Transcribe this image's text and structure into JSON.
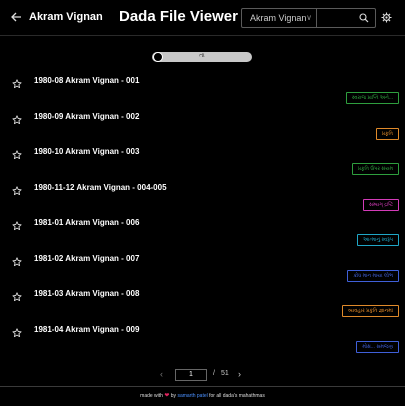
{
  "header": {
    "back_icon": "arrow-left-icon",
    "title": "Akram Vignan",
    "app_title": "Dada File Viewer",
    "select_value": "Akram Vignan",
    "search_placeholder": "",
    "search_icon": "search-icon",
    "settings_icon": "gear-icon"
  },
  "toggle": {
    "label": "તા",
    "state": "off"
  },
  "list": {
    "items": [
      {
        "title": "1980-08 Akram Vignan - 001",
        "tag": "સ્વરાજ પ્રાપ્તિ અને...",
        "tag_color": "#2e9e3e"
      },
      {
        "title": "1980-09 Akram Vignan - 002",
        "tag": "પ્રકૃતિ",
        "tag_color": "#e08a2a"
      },
      {
        "title": "1980-10 Akram Vignan - 003",
        "tag": "પ્રકૃતિ ઉપર સંયમ",
        "tag_color": "#2e9e3e"
      },
      {
        "title": "1980-11-12 Akram Vignan - 004-005",
        "tag": "સમ્યગ્ દ્રષ્ટિ",
        "tag_color": "#d33bb8"
      },
      {
        "title": "1981-01 Akram Vignan - 006",
        "tag": "આત્માનું સ્વરૂપ",
        "tag_color": "#1fa7c7"
      },
      {
        "title": "1981-02 Akram Vignan - 007",
        "tag": "ક્રોધ માન માયા લોભ",
        "tag_color": "#3f5fd8"
      },
      {
        "title": "1981-03 Akram Vignan - 008",
        "tag": "વ્યવહાર પ્રકૃતિ જ્ઞાનમાં",
        "tag_color": "#e08a2a"
      },
      {
        "title": "1981-04 Akram Vignan - 009",
        "tag": "મોક્ષ... સમજણ",
        "tag_color": "#3f5fd8"
      }
    ]
  },
  "pagination": {
    "prev_icon": "chevron-left-icon",
    "current_page": "1",
    "separator": "/",
    "total_pages": "51",
    "next_icon": "chevron-right-icon"
  },
  "footer": {
    "prefix": "made with",
    "heart_icon": "heart-icon",
    "by": "by",
    "author": "samarth patel",
    "suffix": "for all dada's mahathmas"
  }
}
